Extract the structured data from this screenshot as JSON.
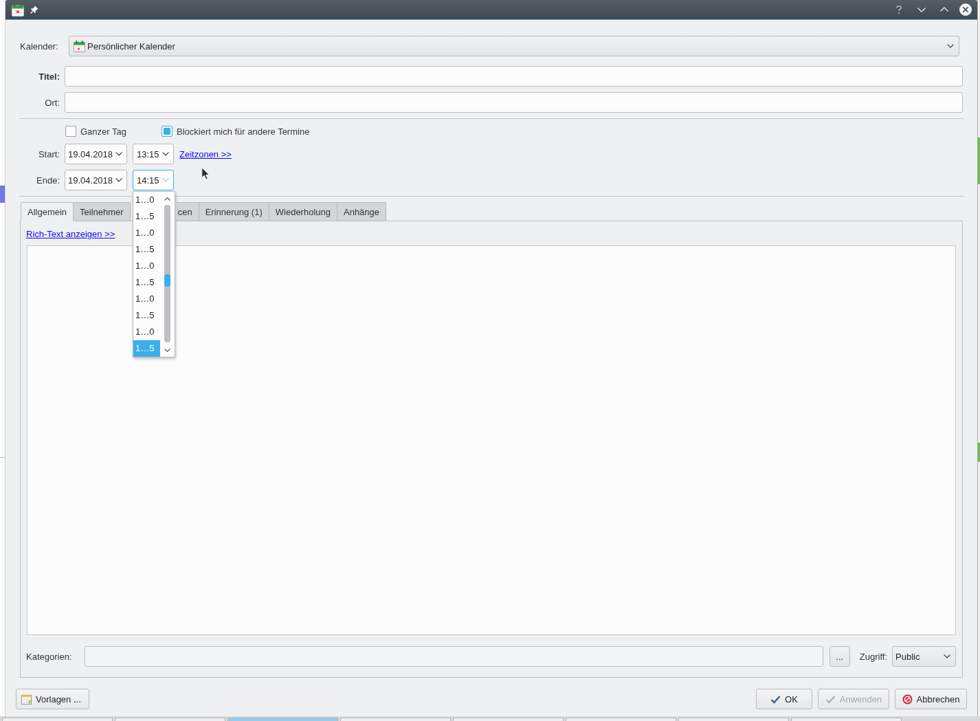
{
  "calendar": {
    "label": "Kalender:",
    "value": "Persönlicher Kalender"
  },
  "fields": [
    {
      "label": "Titel:",
      "emphasized": true
    },
    {
      "label": "Ort:",
      "emphasized": false
    }
  ],
  "options": [
    {
      "label": "Ganzer Tag",
      "checked": false
    },
    {
      "label": "Blockiert mich für andere Termine",
      "checked": true
    }
  ],
  "start": {
    "label": "Start:",
    "date": "19.04.2018",
    "time": "13:15",
    "open": false,
    "link": "Zeitzonen >>"
  },
  "end": {
    "label": "Ende:",
    "date": "19.04.2018",
    "time": "14:15",
    "open": true
  },
  "time_list": [
    {
      "label": "1…0",
      "selected": false
    },
    {
      "label": "1…5",
      "selected": false
    },
    {
      "label": "1…0",
      "selected": false
    },
    {
      "label": "1…5",
      "selected": false
    },
    {
      "label": "1…0",
      "selected": false
    },
    {
      "label": "1…5",
      "selected": false
    },
    {
      "label": "1…0",
      "selected": false
    },
    {
      "label": "1…5",
      "selected": false
    },
    {
      "label": "1…0",
      "selected": false
    },
    {
      "label": "1…5",
      "selected": true
    }
  ],
  "tabs": [
    {
      "label": "Allgemein",
      "selected": true,
      "covered": false
    },
    {
      "label": "Teilnehmer",
      "selected": false,
      "covered": false
    },
    {
      "label": "cen",
      "selected": false,
      "covered": true
    },
    {
      "label": "Erinnerung (1)",
      "selected": false,
      "covered": false
    },
    {
      "label": "Wiederholung",
      "selected": false,
      "covered": false
    },
    {
      "label": "Anhänge",
      "selected": false,
      "covered": false
    }
  ],
  "description": {
    "link": "Rich-Text anzeigen >>"
  },
  "categories": {
    "label": "Kategorien:",
    "button": "..."
  },
  "access": {
    "label": "Zugriff:",
    "value": "Public"
  },
  "templates_button": {
    "label": "Vorlagen ..."
  },
  "buttons": [
    {
      "kind": "ok",
      "label": "OK",
      "disabled": false
    },
    {
      "kind": "apply",
      "label": "Anwenden",
      "disabled": true
    },
    {
      "kind": "cancel",
      "label": "Abbrechen",
      "disabled": false
    }
  ]
}
